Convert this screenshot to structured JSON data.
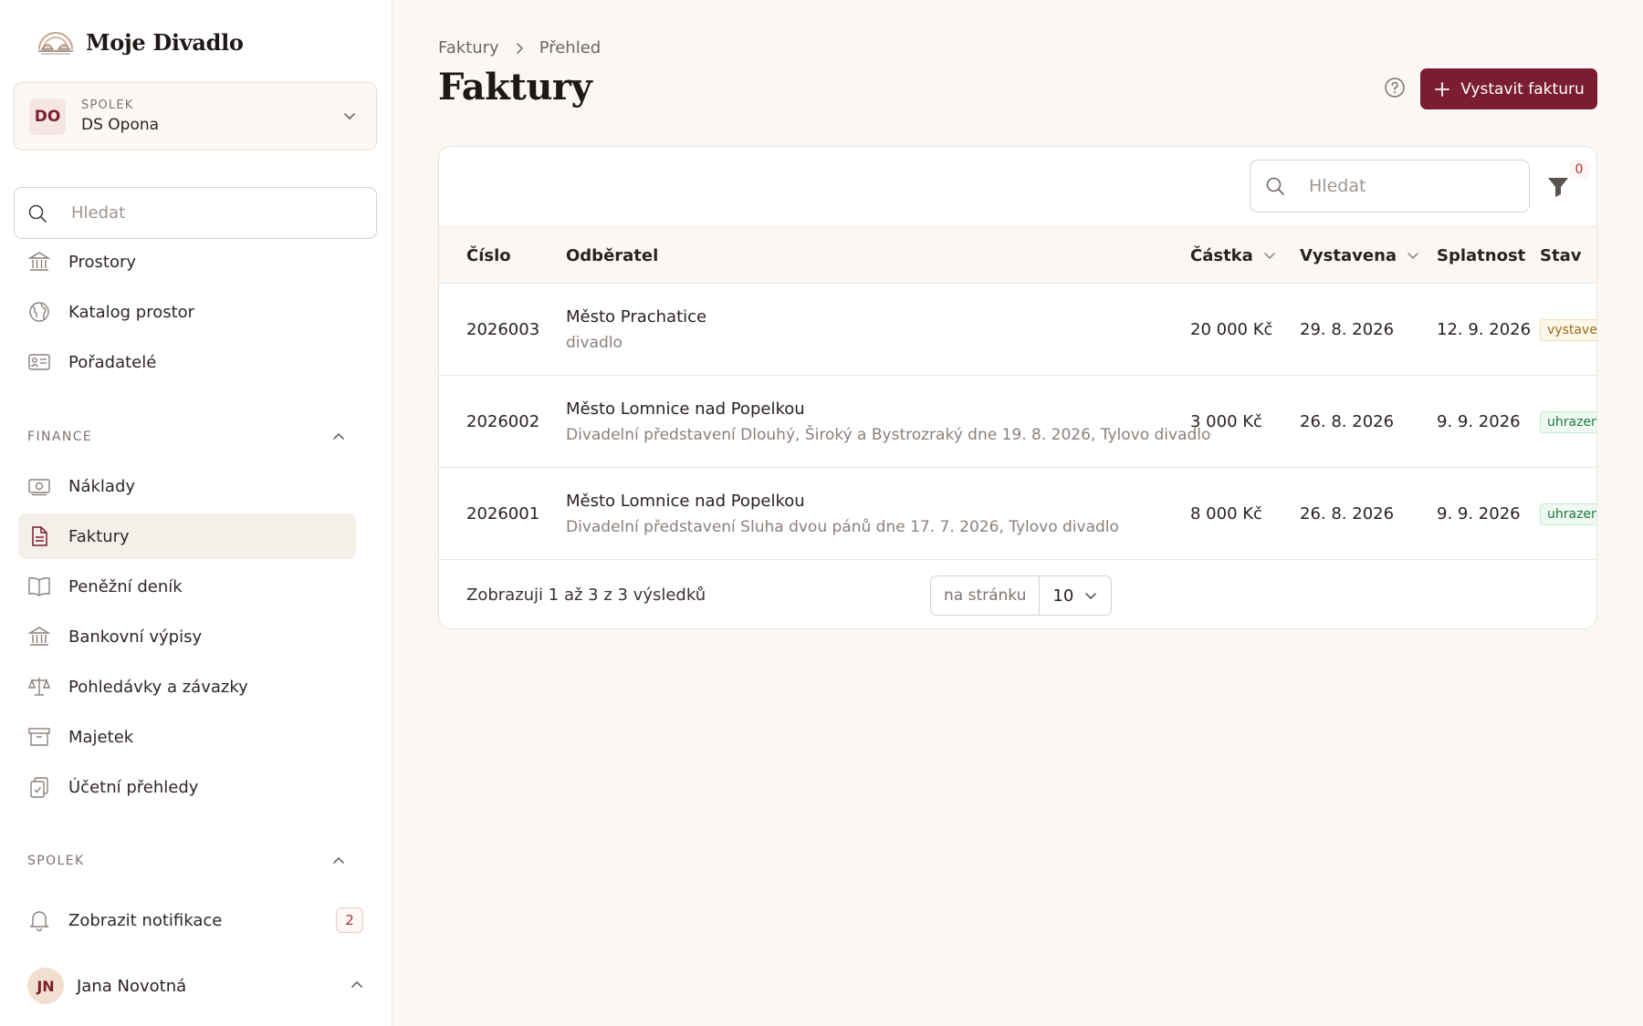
{
  "brand": {
    "name": "Moje Divadlo"
  },
  "org": {
    "badge": "DO",
    "kind": "SPOLEK",
    "name": "DS Opona"
  },
  "sidebar_search": {
    "placeholder": "Hledat"
  },
  "nav_top": [
    {
      "label": "Prostory",
      "icon": "bank-icon"
    },
    {
      "label": "Katalog prostor",
      "icon": "globe-icon"
    },
    {
      "label": "Pořadatelé",
      "icon": "id-card-icon"
    }
  ],
  "section_finance": {
    "title": "FINANCE"
  },
  "nav_finance": [
    {
      "label": "Náklady",
      "icon": "money-icon"
    },
    {
      "label": "Faktury",
      "icon": "document-icon",
      "active": true
    },
    {
      "label": "Peněžní deník",
      "icon": "book-icon"
    },
    {
      "label": "Bankovní výpisy",
      "icon": "bank-icon"
    },
    {
      "label": "Pohledávky a závazky",
      "icon": "scales-icon"
    },
    {
      "label": "Majetek",
      "icon": "archive-icon"
    },
    {
      "label": "Účetní přehledy",
      "icon": "clipboard-icon"
    }
  ],
  "section_spolek": {
    "title": "SPOLEK"
  },
  "notifications": {
    "label": "Zobrazit notifikace",
    "count": "2"
  },
  "user": {
    "initials": "JN",
    "name": "Jana Novotná"
  },
  "breadcrumb": {
    "parent": "Faktury",
    "current": "Přehled"
  },
  "page": {
    "title": "Faktury",
    "primary_action": "Vystavit fakturu"
  },
  "table_search": {
    "placeholder": "Hledat"
  },
  "filter": {
    "count": "0"
  },
  "columns": {
    "number": "Číslo",
    "customer": "Odběratel",
    "amount": "Částka",
    "issued": "Vystavena",
    "due": "Splatnost",
    "status": "Stav"
  },
  "rows": [
    {
      "number": "2026003",
      "customer": "Město Prachatice",
      "description": "divadlo",
      "amount": "20 000 Kč",
      "issued": "29. 8. 2026",
      "due": "12. 9. 2026",
      "status": "vystaven",
      "status_kind": "issued"
    },
    {
      "number": "2026002",
      "customer": "Město Lomnice nad Popelkou",
      "description": "Divadelní představení Dlouhý, Široký a Bystrozraký dne 19. 8. 2026, Tylovo divadlo",
      "amount": "3 000 Kč",
      "issued": "26. 8. 2026",
      "due": "9. 9. 2026",
      "status": "uhrazena",
      "status_kind": "paid"
    },
    {
      "number": "2026001",
      "customer": "Město Lomnice nad Popelkou",
      "description": "Divadelní představení Sluha dvou pánů dne 17. 7. 2026, Tylovo divadlo",
      "amount": "8 000 Kč",
      "issued": "26. 8. 2026",
      "due": "9. 9. 2026",
      "status": "uhrazena",
      "status_kind": "paid"
    }
  ],
  "pagination": {
    "summary": "Zobrazuji 1 až 3 z 3 výsledků",
    "per_page_label": "na stránku",
    "per_page_value": "10"
  },
  "colors": {
    "accent": "#7b1d30",
    "background": "#faf7f4",
    "paid": "#1e7a3c",
    "issued": "#9a6a1a"
  }
}
